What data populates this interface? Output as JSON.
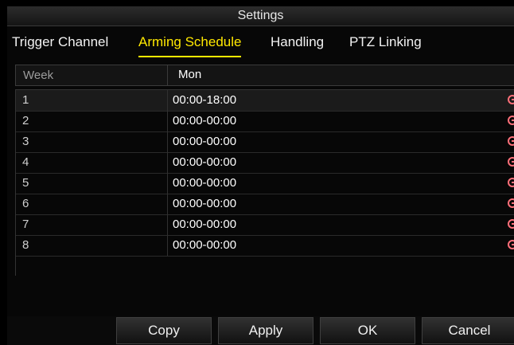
{
  "window": {
    "title": "Settings"
  },
  "tabs": [
    {
      "label": "Trigger Channel",
      "active": false
    },
    {
      "label": "Arming Schedule",
      "active": true
    },
    {
      "label": "Handling",
      "active": false
    },
    {
      "label": "PTZ Linking",
      "active": false
    }
  ],
  "week": {
    "label": "Week",
    "value": "Mon",
    "chevron_icon": "chevron-down-icon"
  },
  "schedule": {
    "rows": [
      {
        "index": "1",
        "time": "00:00-18:00",
        "icon": "clock-icon"
      },
      {
        "index": "2",
        "time": "00:00-00:00",
        "icon": "clock-icon"
      },
      {
        "index": "3",
        "time": "00:00-00:00",
        "icon": "clock-icon"
      },
      {
        "index": "4",
        "time": "00:00-00:00",
        "icon": "clock-icon"
      },
      {
        "index": "5",
        "time": "00:00-00:00",
        "icon": "clock-icon"
      },
      {
        "index": "6",
        "time": "00:00-00:00",
        "icon": "clock-icon"
      },
      {
        "index": "7",
        "time": "00:00-00:00",
        "icon": "clock-icon"
      },
      {
        "index": "8",
        "time": "00:00-00:00",
        "icon": "clock-icon"
      }
    ]
  },
  "buttons": {
    "copy": "Copy",
    "apply": "Apply",
    "ok": "OK",
    "cancel": "Cancel"
  },
  "colors": {
    "active_tab": "#ffe800",
    "clock_icon": "#ff6f79",
    "background": "#070707"
  }
}
